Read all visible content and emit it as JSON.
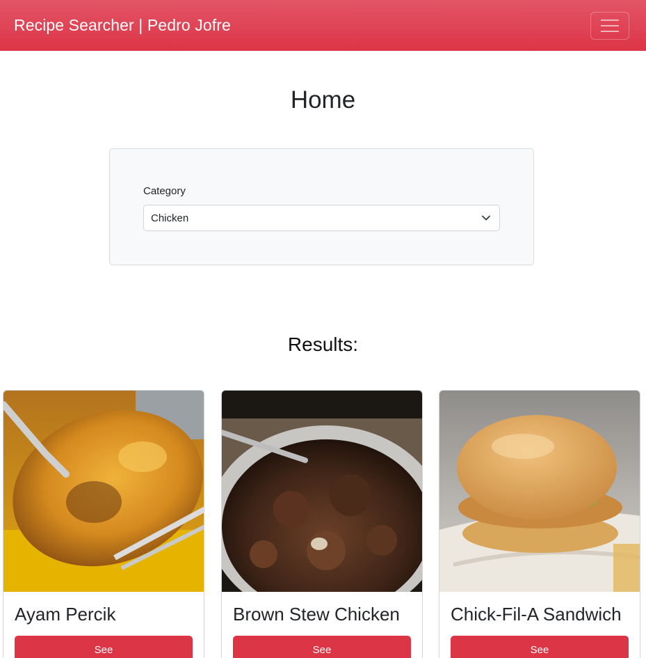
{
  "navbar": {
    "brand": "Recipe Searcher | Pedro Jofre",
    "menu_icon": "hamburger-menu-icon"
  },
  "page": {
    "title": "Home"
  },
  "filter": {
    "label": "Category",
    "selected": "Chicken",
    "chevron_icon": "chevron-down-icon"
  },
  "results": {
    "title": "Results:",
    "cards": [
      {
        "title": "Ayam Percik",
        "button": "See",
        "image": "ayam-percik-photo"
      },
      {
        "title": "Brown Stew Chicken",
        "button": "See",
        "image": "brown-stew-chicken-photo"
      },
      {
        "title": "Chick-Fil-A Sandwich",
        "button": "See",
        "image": "chick-fil-a-sandwich-photo"
      }
    ]
  },
  "colors": {
    "primary": "#dc3545",
    "panel": "#f8f9fa",
    "text": "#212529"
  }
}
